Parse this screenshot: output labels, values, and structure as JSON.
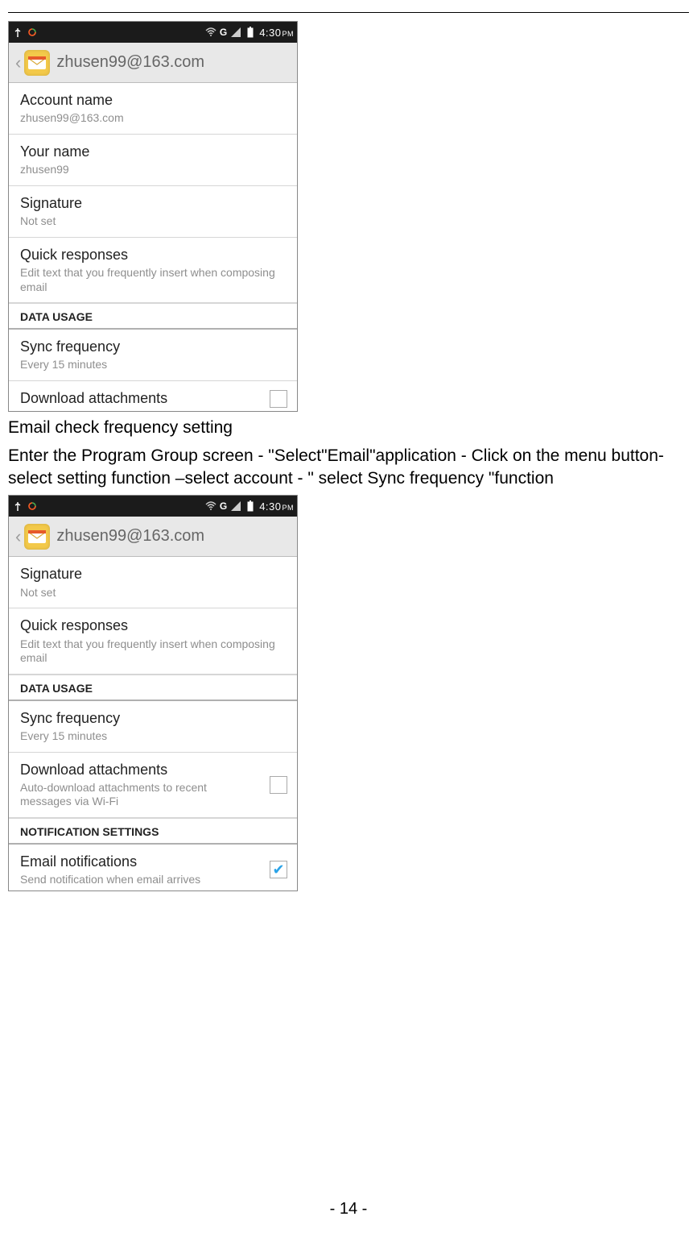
{
  "statusbar": {
    "network_label": "G",
    "time": "4:30",
    "ampm": "PM"
  },
  "appbar": {
    "title": "zhusen99@163.com"
  },
  "screen1": {
    "account_name": {
      "title": "Account name",
      "sub": "zhusen99@163.com"
    },
    "your_name": {
      "title": "Your name",
      "sub": "zhusen99"
    },
    "signature": {
      "title": "Signature",
      "sub": "Not set"
    },
    "quick_responses": {
      "title": "Quick responses",
      "sub": "Edit text that you frequently insert when composing email"
    },
    "data_usage_header": "DATA USAGE",
    "sync_frequency": {
      "title": "Sync frequency",
      "sub": "Every 15 minutes"
    },
    "download_attachments": {
      "title": "Download attachments"
    }
  },
  "doc_text": {
    "heading": "Email check frequency setting",
    "paragraph": "Enter the Program Group screen - \"Select\"Email\"application - Click on the menu button-select setting function –select account - \" select Sync frequency \"function"
  },
  "screen2": {
    "signature": {
      "title": "Signature",
      "sub": "Not set"
    },
    "quick_responses": {
      "title": "Quick responses",
      "sub": "Edit text that you frequently insert when composing email"
    },
    "data_usage_header": "DATA USAGE",
    "sync_frequency": {
      "title": "Sync frequency",
      "sub": "Every 15 minutes"
    },
    "download_attachments": {
      "title": "Download attachments",
      "sub": "Auto-download attachments to recent messages via Wi-Fi"
    },
    "notification_header": "NOTIFICATION SETTINGS",
    "email_notifications": {
      "title": "Email notifications",
      "sub": "Send notification when email arrives"
    }
  },
  "page_number": "- 14 -"
}
